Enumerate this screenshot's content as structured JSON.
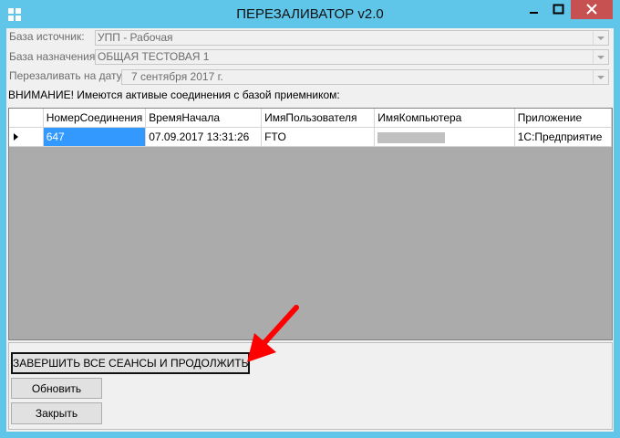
{
  "window": {
    "title": "ПЕРЕЗАЛИВАТОР v2.0",
    "controls": [
      "minimize-icon",
      "maximize-icon",
      "close-icon"
    ],
    "accent_color": "#5fc6ea",
    "close_color": "#c75050"
  },
  "form": {
    "source_label": "База источник:",
    "source_value": "УПП - Рабочая",
    "target_label": "База назначения:",
    "target_value": "ОБЩАЯ ТЕСТОВАЯ 1",
    "date_label": "Перезаливать на дату:",
    "date_value": "7 сентября 2017 г.",
    "warning": "ВНИМАНИЕ! Имеются активые соединения с базой приемником:"
  },
  "grid": {
    "columns": [
      "НомерСоединения",
      "ВремяНачала",
      "ИмяПользователя",
      "ИмяКомпьютера",
      "Приложение"
    ],
    "rows": [
      {
        "connection": "647",
        "start": "07.09.2017 13:31:26",
        "user": "FTO",
        "computer": "",
        "app": "1С:Предприятие"
      }
    ],
    "selection_color": "#3399ff",
    "background_color": "#ababab"
  },
  "buttons": {
    "terminate": "ЗАВЕРШИТЬ ВСЕ СЕАНСЫ И ПРОДОЛЖИТЬ",
    "refresh": "Обновить",
    "close": "Закрыть"
  },
  "annotation": {
    "color": "#ff0000",
    "icon": "red-arrow-icon"
  }
}
